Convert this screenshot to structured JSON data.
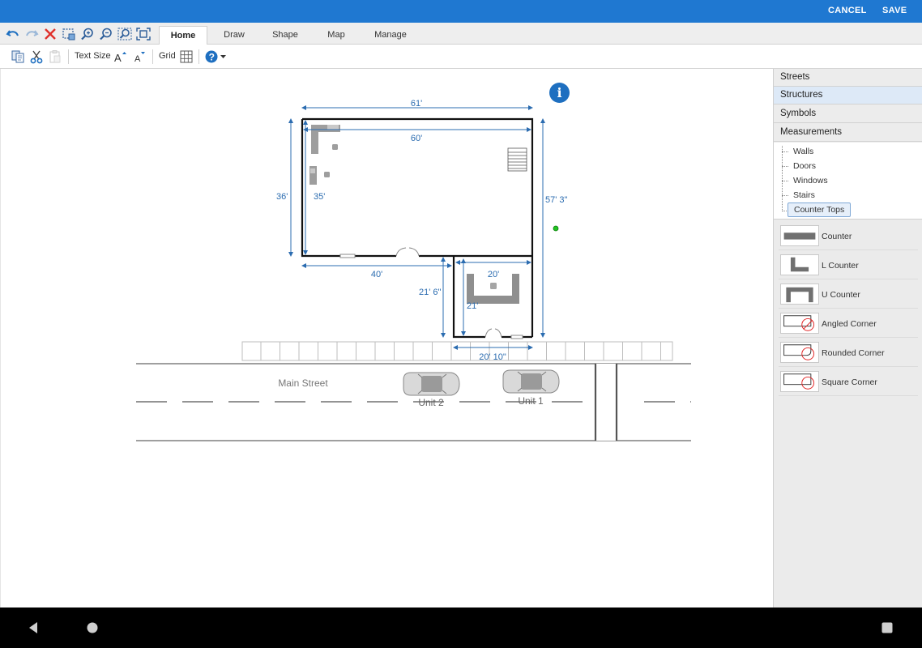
{
  "actionbar": {
    "cancel_label": "CANCEL",
    "save_label": "SAVE",
    "color": "#1f78d1"
  },
  "quick_access": [
    "undo-icon",
    "redo-icon",
    "delete-icon",
    "select-area-icon",
    "zoom-in-icon",
    "zoom-out-icon",
    "zoom-window-icon",
    "fit-to-screen-icon"
  ],
  "tabs": [
    {
      "label": "Home",
      "active": true
    },
    {
      "label": "Draw",
      "active": false
    },
    {
      "label": "Shape",
      "active": false
    },
    {
      "label": "Map",
      "active": false
    },
    {
      "label": "Manage",
      "active": false
    }
  ],
  "toolbar": {
    "icons": [
      "copy-icon",
      "cut-icon",
      "paste-icon"
    ],
    "text_size_label": "Text Size",
    "grid_label": "Grid"
  },
  "side_panel": {
    "categories": [
      {
        "label": "Streets",
        "selected": false
      },
      {
        "label": "Structures",
        "selected": true
      },
      {
        "label": "Symbols",
        "selected": false
      },
      {
        "label": "Measurements",
        "selected": false
      }
    ],
    "tree": [
      {
        "label": "Walls",
        "selected": false
      },
      {
        "label": "Doors",
        "selected": false
      },
      {
        "label": "Windows",
        "selected": false
      },
      {
        "label": "Stairs",
        "selected": false
      },
      {
        "label": "Counter Tops",
        "selected": true
      }
    ],
    "symbols": [
      {
        "label": "Counter"
      },
      {
        "label": "L Counter"
      },
      {
        "label": "U Counter"
      },
      {
        "label": "Angled Corner"
      },
      {
        "label": "Rounded Corner"
      },
      {
        "label": "Square Corner"
      }
    ]
  },
  "drawing": {
    "dimensions": {
      "top_outer": "61'",
      "top_inner": "60'",
      "left_outer": "36'",
      "left_inner": "35'",
      "right": "57' 3\"",
      "bottom_left": "40'",
      "unit_inner_width": "20'",
      "unit_outer_height": "21' 6\"",
      "unit_inner_height": "21'",
      "unit_outer_width": "20' 10\""
    },
    "street_name": "Main Street",
    "car_labels": [
      "Unit 2",
      "Unit 1"
    ],
    "dimension_color": "#2b6cb0"
  }
}
